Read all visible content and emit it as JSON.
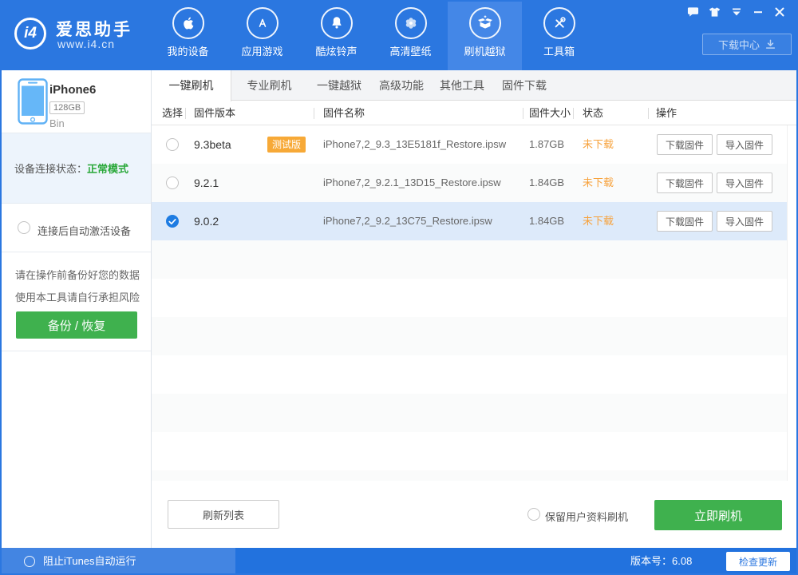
{
  "header": {
    "logo_badge": "i4",
    "logo_title": "爱思助手",
    "logo_subtitle": "www.i4.cn",
    "download_center": "下载中心",
    "nav": [
      {
        "label": "我的设备",
        "icon": "apple-icon",
        "active": false
      },
      {
        "label": "应用游戏",
        "icon": "appstore-icon",
        "active": false
      },
      {
        "label": "酷炫铃声",
        "icon": "bell-icon",
        "active": false
      },
      {
        "label": "高清壁纸",
        "icon": "flower-icon",
        "active": false
      },
      {
        "label": "刷机越狱",
        "icon": "openbox-icon",
        "active": true
      },
      {
        "label": "工具箱",
        "icon": "toolbox-icon",
        "active": false
      }
    ],
    "window_icons": [
      "feedback-bubble-icon",
      "tshirt-skin-icon",
      "minimize-tray-icon",
      "minimize-icon",
      "close-icon"
    ]
  },
  "sidebar": {
    "device": {
      "name": "iPhone6",
      "capacity": "128GB",
      "owner": "Bin"
    },
    "status_label": "设备连接状态：",
    "status_value": "正常模式",
    "auto_activate": "连接后自动激活设备",
    "warning_line1": "请在操作前备份好您的数据",
    "warning_line2": "使用本工具请自行承担风险",
    "backup_button": "备份 / 恢复"
  },
  "tabs": {
    "active_index": 0,
    "items": [
      "一键刷机",
      "专业刷机",
      "一键越狱",
      "高级功能",
      "其他工具",
      "固件下载"
    ]
  },
  "table": {
    "columns": [
      "选择",
      "固件版本",
      "固件名称",
      "固件大小",
      "状态",
      "操作"
    ],
    "rows": [
      {
        "selected": false,
        "version": "9.3beta",
        "badge": "测试版",
        "name": "iPhone7,2_9.3_13E5181f_Restore.ipsw",
        "size": "1.87GB",
        "status": "未下载",
        "actions": [
          "下载固件",
          "导入固件"
        ]
      },
      {
        "selected": false,
        "version": "9.2.1",
        "badge": "",
        "name": "iPhone7,2_9.2.1_13D15_Restore.ipsw",
        "size": "1.84GB",
        "status": "未下载",
        "actions": [
          "下载固件",
          "导入固件"
        ]
      },
      {
        "selected": true,
        "version": "9.0.2",
        "badge": "",
        "name": "iPhone7,2_9.2_13C75_Restore.ipsw",
        "size": "1.84GB",
        "status": "未下载",
        "actions": [
          "下载固件",
          "导入固件"
        ]
      }
    ]
  },
  "action_bar": {
    "refresh": "刷新列表",
    "keep_user_data": "保留用户资料刷机",
    "flash_now": "立即刷机"
  },
  "footer": {
    "block_itunes": "阻止iTunes自动运行",
    "version": "版本号：6.08",
    "check_update": "检查更新"
  },
  "colors": {
    "accent_blue": "#2b77e0",
    "nav_active_blue": "#4487e7",
    "footer_left_blue": "#4385e2",
    "selected_row_blue": "#ddeafa",
    "radio_checked_blue": "#1e7ce2",
    "green_button": "#3fb14e",
    "status_green": "#2aa83a",
    "orange_badge": "#f7a937",
    "orange_status_text": "#f7a23c",
    "section_status_bg": "#edf4fc"
  }
}
